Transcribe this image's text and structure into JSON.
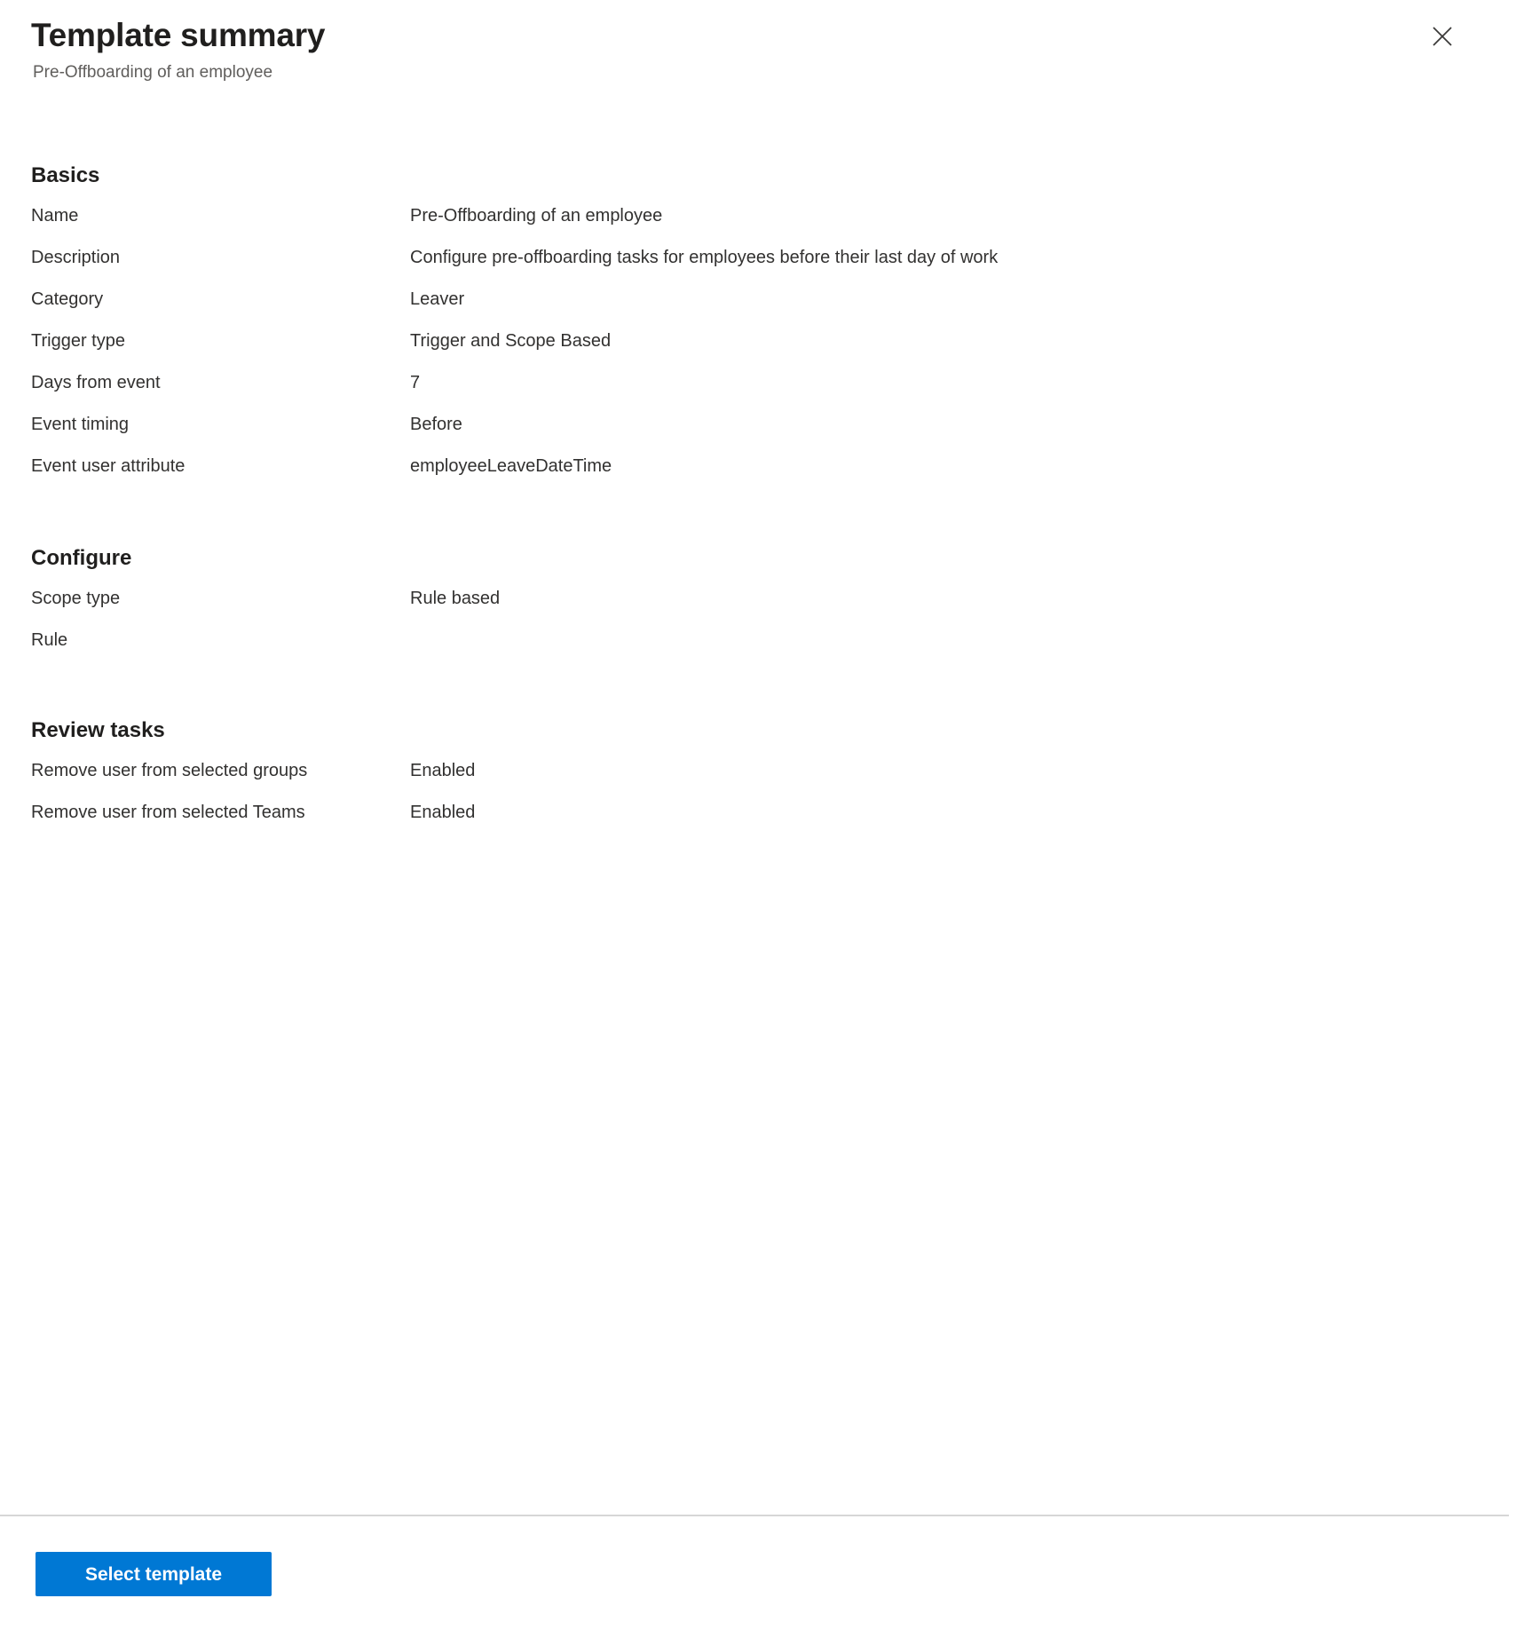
{
  "header": {
    "title": "Template summary",
    "subtitle": "Pre-Offboarding of an employee",
    "close_icon": "close-icon"
  },
  "sections": [
    {
      "id": "basics",
      "title": "Basics",
      "rows": [
        {
          "label": "Name",
          "value": "Pre-Offboarding of an employee"
        },
        {
          "label": "Description",
          "value": "Configure pre-offboarding tasks for employees before their last day of work"
        },
        {
          "label": "Category",
          "value": "Leaver"
        },
        {
          "label": "Trigger type",
          "value": "Trigger and Scope Based"
        },
        {
          "label": "Days from event",
          "value": "7"
        },
        {
          "label": "Event timing",
          "value": "Before"
        },
        {
          "label": "Event user attribute",
          "value": "employeeLeaveDateTime"
        }
      ]
    },
    {
      "id": "configure",
      "title": "Configure",
      "rows": [
        {
          "label": "Scope type",
          "value": "Rule based"
        },
        {
          "label": "Rule",
          "value": ""
        }
      ]
    },
    {
      "id": "review_tasks",
      "title": "Review tasks",
      "rows": [
        {
          "label": "Remove user from selected groups",
          "value": "Enabled"
        },
        {
          "label": "Remove user from selected Teams",
          "value": "Enabled"
        }
      ]
    }
  ],
  "footer": {
    "primary_button_label": "Select template"
  },
  "colors": {
    "accent": "#0078d4",
    "text": "#323130",
    "subtle_text": "#605e5c",
    "divider": "#d6d6d6",
    "background": "#ffffff"
  }
}
